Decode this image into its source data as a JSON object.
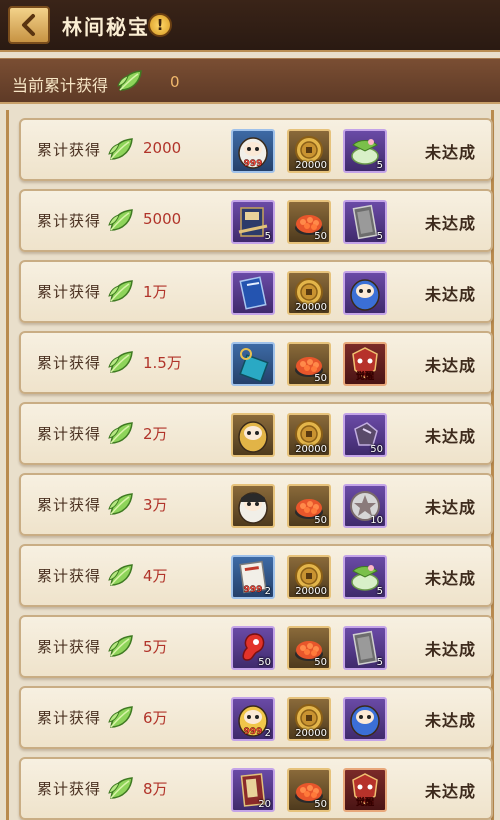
{
  "header": {
    "title": "林间秘宝",
    "info_symbol": "!"
  },
  "summary": {
    "label": "当前累计获得",
    "value": "0",
    "currency_icon": "leaf-icon"
  },
  "colors": {
    "amount": "#b1342a",
    "header_bg": "#2a1a12",
    "summary_bg": "#5e3a26"
  },
  "rows": [
    {
      "label": "累计获得",
      "amount": "2000",
      "status": "未达成",
      "items": [
        {
          "icon": "daruma-doll-icon",
          "count": "",
          "overlay": "999",
          "quality": "blue"
        },
        {
          "icon": "gold-coin-icon",
          "count": "20000",
          "quality": "gold"
        },
        {
          "icon": "rice-cake-icon",
          "count": "5",
          "quality": "purple"
        }
      ]
    },
    {
      "label": "累计获得",
      "amount": "5000",
      "status": "未达成",
      "items": [
        {
          "icon": "scroll-pack-icon",
          "count": "5",
          "quality": "purple"
        },
        {
          "icon": "sushi-icon",
          "count": "50",
          "quality": "gold"
        },
        {
          "icon": "blank-talisman-icon",
          "count": "5",
          "quality": "purple"
        }
      ]
    },
    {
      "label": "累计获得",
      "amount": "1万",
      "status": "未达成",
      "items": [
        {
          "icon": "blue-talisman-icon",
          "count": "",
          "quality": "purple"
        },
        {
          "icon": "gold-coin-icon",
          "count": "20000",
          "quality": "gold"
        },
        {
          "icon": "blue-daruma-icon",
          "count": "",
          "quality": "purple"
        }
      ]
    },
    {
      "label": "累计获得",
      "amount": "1.5万",
      "status": "未达成",
      "items": [
        {
          "icon": "jade-amulet-icon",
          "count": "",
          "quality": "blue"
        },
        {
          "icon": "sushi-icon",
          "count": "50",
          "quality": "gold"
        },
        {
          "icon": "awaken-mask-icon",
          "count": "",
          "overlay": "觉醒",
          "quality": "red"
        }
      ]
    },
    {
      "label": "累计获得",
      "amount": "2万",
      "status": "未达成",
      "items": [
        {
          "icon": "gold-daruma-icon",
          "count": "",
          "quality": "gold"
        },
        {
          "icon": "gold-coin-icon",
          "count": "20000",
          "quality": "gold"
        },
        {
          "icon": "purple-stone-icon",
          "count": "50",
          "quality": "purple"
        }
      ]
    },
    {
      "label": "累计获得",
      "amount": "3万",
      "status": "未达成",
      "items": [
        {
          "icon": "black-daruma-icon",
          "count": "",
          "quality": "gold"
        },
        {
          "icon": "sushi-icon",
          "count": "50",
          "quality": "gold"
        },
        {
          "icon": "star-seal-icon",
          "count": "10",
          "quality": "purple"
        }
      ]
    },
    {
      "label": "累计获得",
      "amount": "4万",
      "status": "未达成",
      "items": [
        {
          "icon": "scroll-ticket-icon",
          "count": "2",
          "overlay": "999",
          "quality": "blue"
        },
        {
          "icon": "gold-coin-icon",
          "count": "20000",
          "quality": "gold"
        },
        {
          "icon": "rice-cake-icon",
          "count": "5",
          "quality": "purple"
        }
      ]
    },
    {
      "label": "累计获得",
      "amount": "5万",
      "status": "未达成",
      "items": [
        {
          "icon": "red-magatama-icon",
          "count": "50",
          "quality": "purple"
        },
        {
          "icon": "sushi-icon",
          "count": "50",
          "quality": "gold"
        },
        {
          "icon": "blank-talisman-icon",
          "count": "5",
          "quality": "purple"
        }
      ]
    },
    {
      "label": "累计获得",
      "amount": "6万",
      "status": "未达成",
      "items": [
        {
          "icon": "golden-daruma-burst-icon",
          "count": "2",
          "overlay": "999",
          "quality": "purple"
        },
        {
          "icon": "gold-coin-icon",
          "count": "20000",
          "quality": "gold"
        },
        {
          "icon": "blue-daruma-icon",
          "count": "",
          "quality": "purple"
        }
      ]
    },
    {
      "label": "累计获得",
      "amount": "8万",
      "status": "未达成",
      "items": [
        {
          "icon": "red-book-icon",
          "count": "20",
          "quality": "purple"
        },
        {
          "icon": "sushi-icon",
          "count": "50",
          "quality": "gold"
        },
        {
          "icon": "awaken-mask-icon",
          "count": "",
          "overlay": "觉醒",
          "quality": "red"
        }
      ]
    }
  ]
}
